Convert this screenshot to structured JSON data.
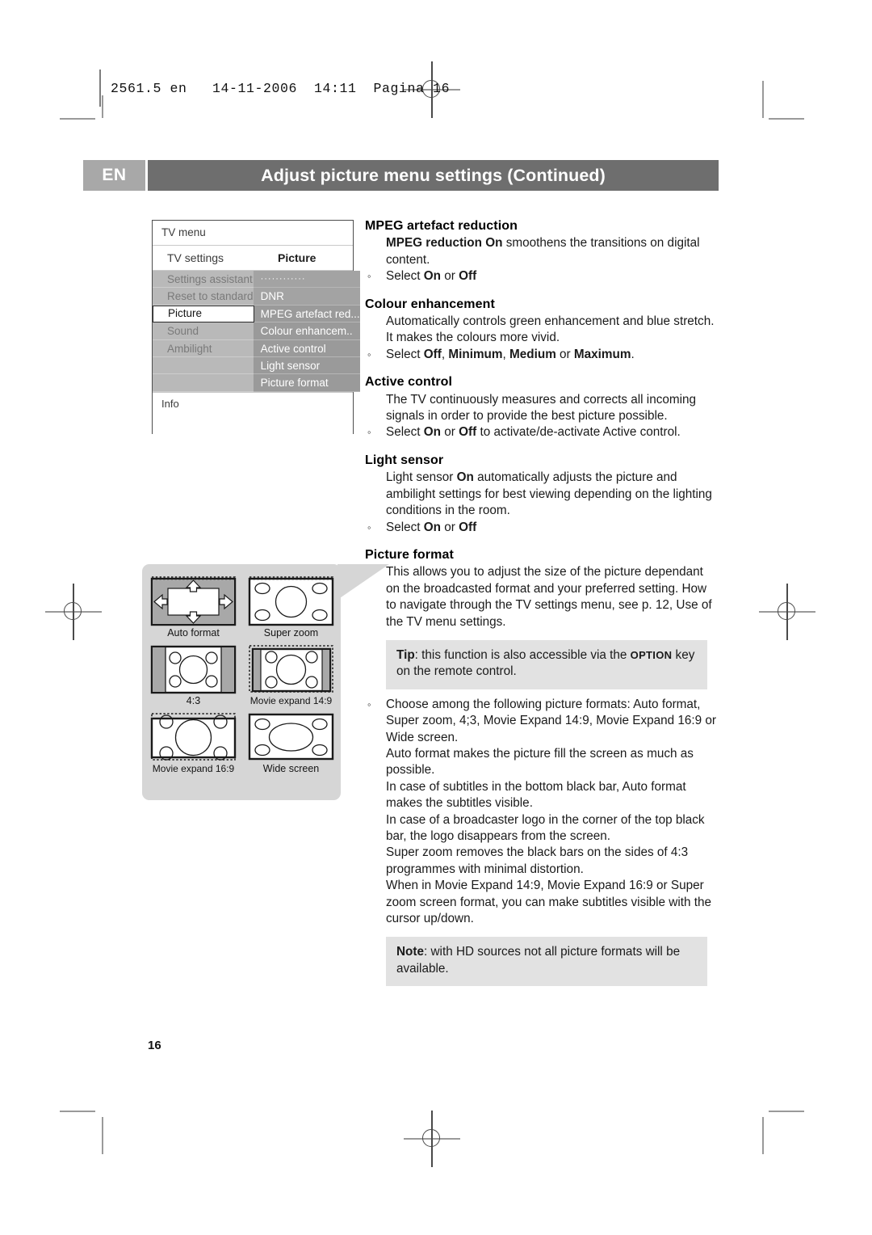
{
  "print_meta": {
    "text": "2561.5 en   14-11-2006  14:11  Pagina 16"
  },
  "header": {
    "language_tag": "EN",
    "title": "Adjust picture menu settings  (Continued)"
  },
  "tv_menu": {
    "title": "TV menu",
    "submenu_label": "TV settings",
    "panel_label": "Picture",
    "left_items": [
      "Settings assistant",
      "Reset to standard",
      "Picture",
      "Sound",
      "Ambilight"
    ],
    "selected_left_item": "Picture",
    "right_items": [
      "············",
      "DNR",
      "MPEG artefact red...",
      "Colour enhancem..",
      "Active control",
      "Light sensor",
      "Picture format"
    ],
    "info_label": "Info"
  },
  "picture_formats": {
    "items": [
      {
        "key": "auto-format",
        "label": "Auto format"
      },
      {
        "key": "super-zoom",
        "label": "Super zoom"
      },
      {
        "key": "four-three",
        "label": "4:3"
      },
      {
        "key": "movie-expand-14-9",
        "label": "Movie expand 14:9"
      },
      {
        "key": "movie-expand-16-9",
        "label": "Movie expand 16:9"
      },
      {
        "key": "wide-screen",
        "label": "Wide screen"
      }
    ]
  },
  "sections": {
    "mpeg": {
      "heading": "MPEG artefact reduction",
      "body_bold_lead": "MPEG reduction On",
      "body_rest": " smoothens the transitions on digital content.",
      "bullet_lead": "Select ",
      "bullet_on": "On",
      "bullet_mid": " or ",
      "bullet_off": "Off"
    },
    "colour": {
      "heading": "Colour enhancement",
      "body": "Automatically controls green enhancement and blue stretch. It makes the colours more vivid.",
      "bullet_lead": "Select ",
      "opt1": "Off",
      "sep1": ", ",
      "opt2": "Minimum",
      "sep2": ", ",
      "opt3": "Medium",
      "sep3": " or ",
      "opt4": "Maximum",
      "tail": "."
    },
    "active_control": {
      "heading": "Active control",
      "body": "The TV continuously measures and corrects all incoming signals in order to provide the best picture possible.",
      "bullet_lead": "Select ",
      "bullet_on": "On",
      "bullet_mid": " or ",
      "bullet_off": "Off",
      "bullet_tail": " to activate/de-activate Active control."
    },
    "light_sensor": {
      "heading": "Light sensor",
      "body_lead": "Light sensor ",
      "body_bold": "On",
      "body_rest": " automatically adjusts the picture and ambilight settings for best viewing depending on the lighting conditions in the room.",
      "bullet_lead": "Select ",
      "bullet_on": "On",
      "bullet_mid": " or ",
      "bullet_off": "Off"
    },
    "picture_format": {
      "heading": "Picture format",
      "body": "This allows you to adjust the size of the picture dependant on the broadcasted format and your preferred setting. How to navigate through the TV settings menu, see p. 12, Use of the TV menu settings.",
      "tip_label": "Tip",
      "tip_text_1": ": this function is also accessible via the ",
      "tip_key": "OPTION",
      "tip_text_2": " key on the remote control.",
      "bullet_body": "Choose among the following picture formats: Auto format, Super zoom, 4;3, Movie Expand 14:9, Movie Expand 16:9 or Wide screen.",
      "para_2": "Auto format makes the picture fill the screen as much as possible.",
      "para_3": "In case of subtitles in the bottom black bar, Auto format makes the subtitles visible.",
      "para_4": "In case of a broadcaster logo in the  corner of the top black bar, the logo disappears from the screen.",
      "para_5": "Super zoom removes the black bars on the sides of 4:3 programmes with minimal distortion.",
      "para_6": "When in Movie Expand 14:9, Movie Expand 16:9 or Super zoom screen format, you can make subtitles visible with the cursor up/down.",
      "note_label": "Note",
      "note_text": ": with HD sources not all picture formats will be available."
    }
  },
  "footer": {
    "page_number": "16"
  },
  "colors": {
    "title_band": "#6e6e6e",
    "lang_tag": "#a8a8a8",
    "menu_left_bg": "#b9b9b9",
    "menu_right_bg": "#a3a3a3",
    "menu_right_highlight": "#9a9a9a",
    "callout_bg": "#d6d6d6",
    "tip_bg": "#e2e2e2"
  }
}
